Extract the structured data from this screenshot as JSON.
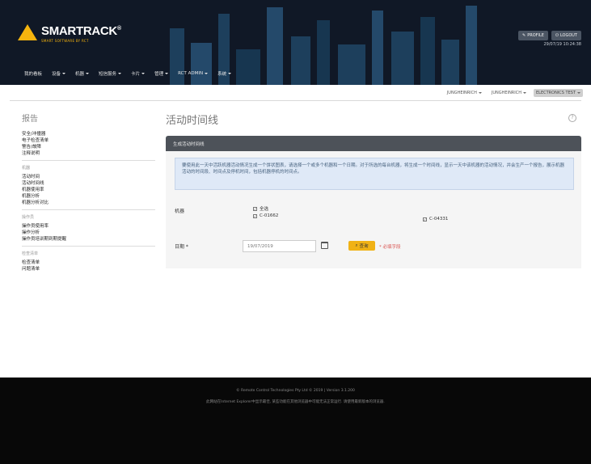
{
  "header": {
    "logo_name": "SMARTRACK",
    "logo_reg": "®",
    "logo_tag": "SMART SOFTWARE BY RCT",
    "profile_label": "PROFILE",
    "logout_label": "LOGOUT",
    "datetime": "29/07/19 10:24:38"
  },
  "nav": [
    {
      "label": "我的看板",
      "caret": false
    },
    {
      "label": "设备",
      "caret": true
    },
    {
      "label": "机器",
      "caret": true
    },
    {
      "label": "短信服务",
      "caret": true
    },
    {
      "label": "卡片",
      "caret": true
    },
    {
      "label": "管理",
      "caret": true
    },
    {
      "label": "RCT ADMIN",
      "caret": true
    },
    {
      "label": "系统",
      "caret": true
    }
  ],
  "context": [
    {
      "label": "JUNGHEINRICH",
      "active": false
    },
    {
      "label": "JUNGHEINRICH",
      "active": false
    },
    {
      "label": "ELECTRONICS TEST",
      "active": true
    }
  ],
  "sidebar": {
    "title": "报告",
    "groups": [
      {
        "heading": "",
        "links": [
          "安全/冲撞器",
          "电子检查清单",
          "警告/故障",
          "注释说明"
        ]
      },
      {
        "heading": "机器",
        "links": [
          "活动时间",
          "活动时间线",
          "机器使用率",
          "机器分析",
          "机器分析对比"
        ]
      },
      {
        "heading": "操作员",
        "links": [
          "操作员使用率",
          "操作分析",
          "操作员培训期到期提醒"
        ]
      },
      {
        "heading": "检查清单",
        "links": [
          "检查清单",
          "问题清单"
        ]
      }
    ]
  },
  "main": {
    "title": "活动时间线",
    "help_glyph": "?",
    "panel_header": "生成活动时间线",
    "info_text": "要使用此一天中活跃机器活动情况生成一个饼状图表，请选择一个或多个机器和一个日期。对于所选的每台机器，将生成一个时间线，显示一天中该机器的活动情况，并会生产一个报告，展示机器活动的时间段、时间点及停机时间，包括机器停机的时间点。",
    "machine_label": "机器",
    "select_all_label": "全选",
    "machines": [
      "C-01662",
      "C-04331"
    ],
    "date_label": "日期 *",
    "date_value": "19/07/2019",
    "search_label": "查询",
    "required_note": "* 必填字段"
  },
  "footer": {
    "line1": "© Remote Control Technologies Pty Ltd © 2019 | Version 3.1.200",
    "line2": "此网站在Internet Explorer中显示最佳, 某些功能在其他浏览器中可能无法正常运行. 请使用最新版本的浏览器."
  },
  "colors": {
    "header_bg": "#101826",
    "accent": "#f6b40e",
    "panel_head": "#4d5259",
    "info_bg": "#dfe9f7",
    "footer_bg": "#080808"
  }
}
